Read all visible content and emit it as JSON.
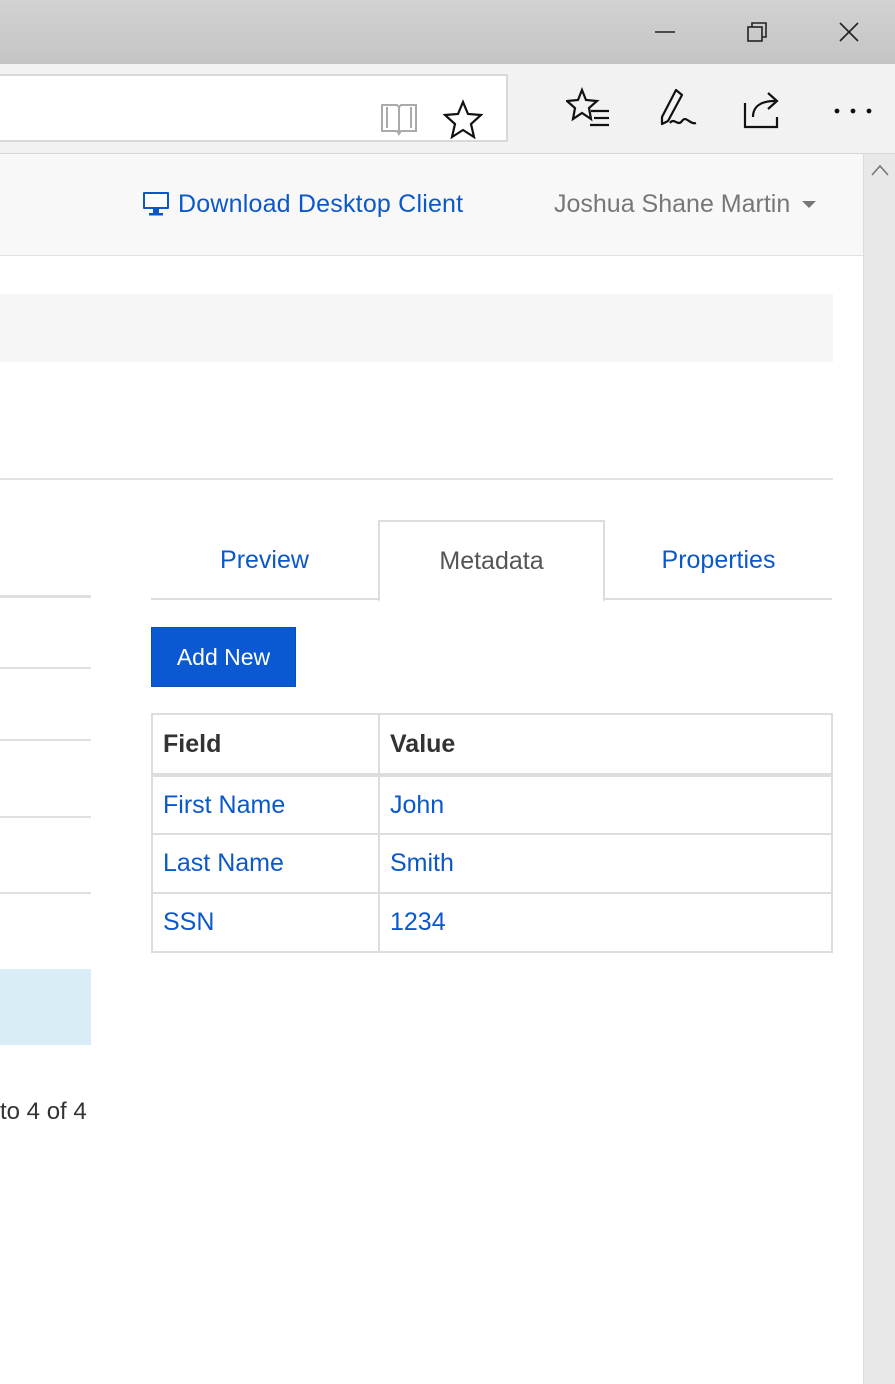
{
  "window": {
    "minimize_glyph": "minimize-icon",
    "restore_glyph": "restore-icon",
    "close_glyph": "close-icon"
  },
  "toolbar": {
    "icons": [
      "reading-view-icon",
      "favorite-star-icon",
      "hub-icon",
      "pen-icon",
      "share-icon",
      "more-icon"
    ]
  },
  "navbar": {
    "download_label": "Download Desktop Client",
    "user_name": "Joshua Shane Martin"
  },
  "left_panel": {
    "paging_text": "to 4 of 4"
  },
  "tabs": [
    {
      "label": "Preview",
      "active": false
    },
    {
      "label": "Metadata",
      "active": true
    },
    {
      "label": "Properties",
      "active": false
    }
  ],
  "actions": {
    "add_new_label": "Add New"
  },
  "metadata_table": {
    "headers": [
      "Field",
      "Value"
    ],
    "rows": [
      {
        "field": "First Name",
        "value": "John"
      },
      {
        "field": "Last Name",
        "value": "Smith"
      },
      {
        "field": "SSN",
        "value": "1234"
      }
    ]
  },
  "colors": {
    "link": "#0b59c9",
    "primary_button": "#0b59d2",
    "highlight_row": "#d9edf7"
  }
}
